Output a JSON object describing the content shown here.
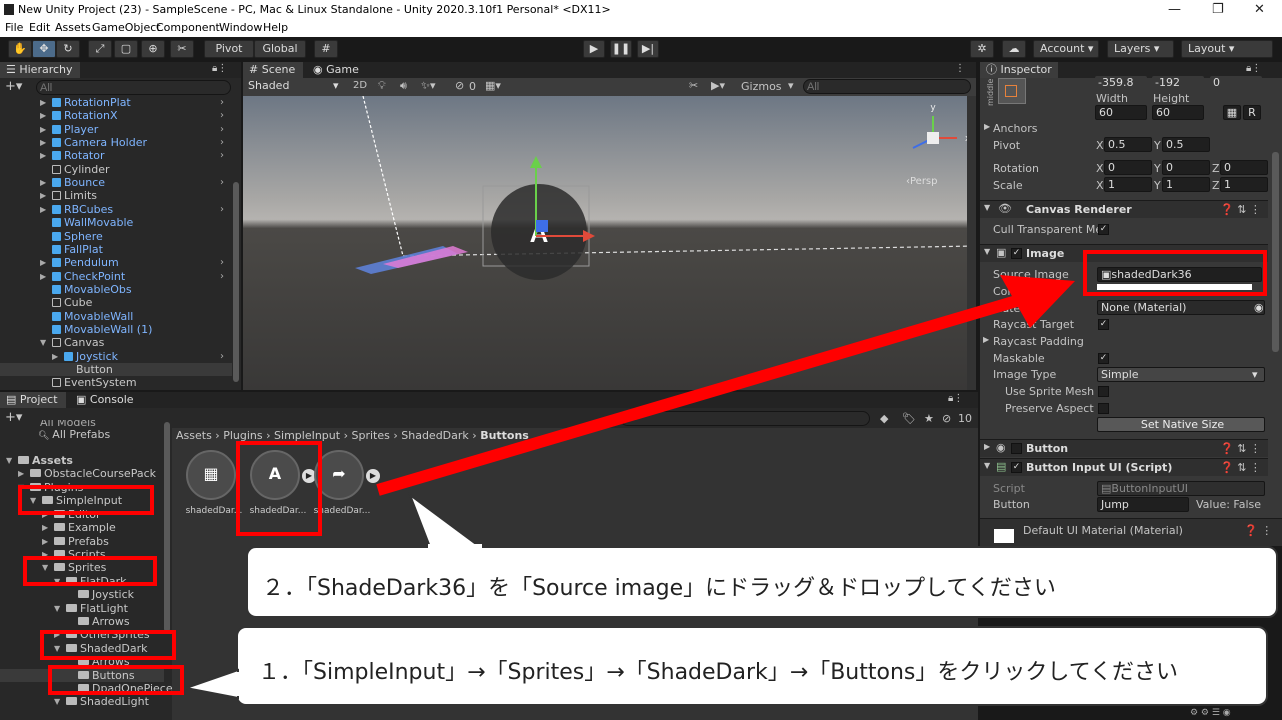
{
  "window": {
    "title": "New Unity Project (23) - SampleScene - PC, Mac & Linux Standalone - Unity 2020.3.10f1 Personal* <DX11>",
    "min": "—",
    "max": "❐",
    "close": "✕"
  },
  "menu": [
    "File",
    "Edit",
    "Assets",
    "GameObject",
    "Component",
    "Window",
    "Help"
  ],
  "toolbar": {
    "pivot": "Pivot",
    "global": "Global",
    "account": "Account",
    "layers": "Layers",
    "layout": "Layout"
  },
  "hierarchy": {
    "tab": "Hierarchy",
    "search_placeholder": "All",
    "items": [
      {
        "label": "RotationPlat",
        "color": "blue",
        "icon": "prefab",
        "expand": true
      },
      {
        "label": "RotationX",
        "color": "blue",
        "icon": "prefab",
        "expand": true
      },
      {
        "label": "Player",
        "color": "blue",
        "icon": "prefab",
        "expand": true
      },
      {
        "label": "Camera Holder",
        "color": "blue",
        "icon": "prefab",
        "expand": true
      },
      {
        "label": "Rotator",
        "color": "blue",
        "icon": "prefab",
        "expand": true
      },
      {
        "label": "Cylinder",
        "color": "gray",
        "icon": "object",
        "expand": false
      },
      {
        "label": "Bounce",
        "color": "blue",
        "icon": "prefab",
        "expand": true
      },
      {
        "label": "Limits",
        "color": "gray",
        "icon": "object",
        "expand": true
      },
      {
        "label": "RBCubes",
        "color": "blue",
        "icon": "prefab",
        "expand": true
      },
      {
        "label": "WallMovable",
        "color": "blue",
        "icon": "prefab",
        "expand": false
      },
      {
        "label": "Sphere",
        "color": "blue",
        "icon": "prefab",
        "expand": false
      },
      {
        "label": "FallPlat",
        "color": "blue",
        "icon": "prefab",
        "expand": false
      },
      {
        "label": "Pendulum",
        "color": "blue",
        "icon": "prefab",
        "expand": true
      },
      {
        "label": "CheckPoint",
        "color": "blue",
        "icon": "prefab",
        "expand": true
      },
      {
        "label": "MovableObs",
        "color": "blue",
        "icon": "prefab",
        "expand": false
      },
      {
        "label": "Cube",
        "color": "gray",
        "icon": "object",
        "expand": false
      },
      {
        "label": "MovableWall",
        "color": "blue",
        "icon": "prefab",
        "expand": false
      },
      {
        "label": "MovableWall (1)",
        "color": "blue",
        "icon": "prefab",
        "expand": false
      },
      {
        "label": "Canvas",
        "color": "gray",
        "icon": "object",
        "expand": true
      },
      {
        "label": "Joystick",
        "color": "blue",
        "icon": "prefab",
        "expand": true
      },
      {
        "label": "Button",
        "color": "gray",
        "icon": "none",
        "expand": false
      },
      {
        "label": "EventSystem",
        "color": "gray",
        "icon": "object",
        "expand": false
      }
    ]
  },
  "scene": {
    "tab_scene": "Scene",
    "tab_game": "Game",
    "shading": "Shaded",
    "mode_2d": "2D",
    "hidden_count": "0",
    "gizmos": "Gizmos",
    "search_placeholder": "All",
    "view_label": "‹Persp",
    "button_letter": "A"
  },
  "project": {
    "tab_project": "Project",
    "tab_console": "Console",
    "hidden_count": "10",
    "tree_partial": "All Models",
    "tree": [
      {
        "label": "All Prefabs",
        "indent": 0,
        "kind": "search"
      },
      {
        "label": "Assets",
        "indent": 0,
        "kind": "folder-open"
      },
      {
        "label": "ObstacleCoursePack",
        "indent": 1,
        "kind": "folder"
      },
      {
        "label": "Plugins",
        "indent": 1,
        "kind": "folder-open"
      },
      {
        "label": "SimpleInput",
        "indent": 2,
        "kind": "folder-open"
      },
      {
        "label": "Editor",
        "indent": 3,
        "kind": "folder"
      },
      {
        "label": "Example",
        "indent": 3,
        "kind": "folder"
      },
      {
        "label": "Prefabs",
        "indent": 3,
        "kind": "folder"
      },
      {
        "label": "Scripts",
        "indent": 3,
        "kind": "folder"
      },
      {
        "label": "Sprites",
        "indent": 3,
        "kind": "folder-open"
      },
      {
        "label": "FlatDark",
        "indent": 4,
        "kind": "folder-open"
      },
      {
        "label": "Joystick",
        "indent": 5,
        "kind": "folder"
      },
      {
        "label": "FlatLight",
        "indent": 4,
        "kind": "folder-open"
      },
      {
        "label": "Arrows",
        "indent": 5,
        "kind": "folder"
      },
      {
        "label": "OtherSprites",
        "indent": 4,
        "kind": "folder"
      },
      {
        "label": "ShadedDark",
        "indent": 4,
        "kind": "folder-open"
      },
      {
        "label": "Arrows",
        "indent": 5,
        "kind": "folder"
      },
      {
        "label": "Buttons",
        "indent": 5,
        "kind": "folder"
      },
      {
        "label": "DpadOnePiece",
        "indent": 5,
        "kind": "folder"
      },
      {
        "label": "ShadedLight",
        "indent": 4,
        "kind": "folder-open"
      }
    ],
    "breadcrumb": [
      "Assets",
      "Plugins",
      "SimpleInput",
      "Sprites",
      "ShadedDark",
      "Buttons"
    ],
    "files": [
      {
        "label": "shadedDar...",
        "glyph": "▦"
      },
      {
        "label": "shadedDar...",
        "glyph": "A"
      },
      {
        "label": "shadedDar...",
        "glyph": "➦"
      }
    ]
  },
  "inspector": {
    "tab": "Inspector",
    "middle": "middle",
    "pos": [
      "-359.8",
      "-192",
      "0"
    ],
    "width_label": "Width",
    "height_label": "Height",
    "width": "60",
    "height": "60",
    "r_label": "R",
    "anchors": "Anchors",
    "pivot_label": "Pivot",
    "pivot": {
      "x": "0.5",
      "y": "0.5"
    },
    "rotation_label": "Rotation",
    "rotation": {
      "x": "0",
      "y": "0",
      "z": "0"
    },
    "scale_label": "Scale",
    "scale": {
      "x": "1",
      "y": "1",
      "z": "1"
    },
    "axis": {
      "x": "X",
      "y": "Y",
      "z": "Z"
    },
    "canvas_renderer": "Canvas Renderer",
    "cull": "Cull Transparent Mes",
    "image": "Image",
    "source_image_label": "Source Image",
    "source_image": "shadedDark36",
    "color_label": "Color",
    "material_label": "Material",
    "material": "None (Material)",
    "raycast_target": "Raycast Target",
    "raycast_padding": "Raycast Padding",
    "maskable": "Maskable",
    "image_type_label": "Image Type",
    "image_type": "Simple",
    "use_sprite_mesh": "Use Sprite Mesh",
    "preserve_aspect": "Preserve Aspect",
    "set_native_size": "Set Native Size",
    "button": "Button",
    "button_input": "Button Input UI (Script)",
    "script_label": "Script",
    "script": "ButtonInputUI",
    "button_label": "Button",
    "button_value": "Jump",
    "value_text": "Value: False",
    "default_material": "Default UI Material (Material)"
  },
  "callouts": {
    "step2": "２．「ShadeDark36」を「Source image」にドラッグ＆ドロップしてください",
    "step1": "１．「SimpleInput」→「Sprites」→「ShadeDark」→「Buttons」をクリックしてください"
  },
  "colors": {
    "highlight": "#ff0000",
    "selection": "#2c5d87"
  }
}
